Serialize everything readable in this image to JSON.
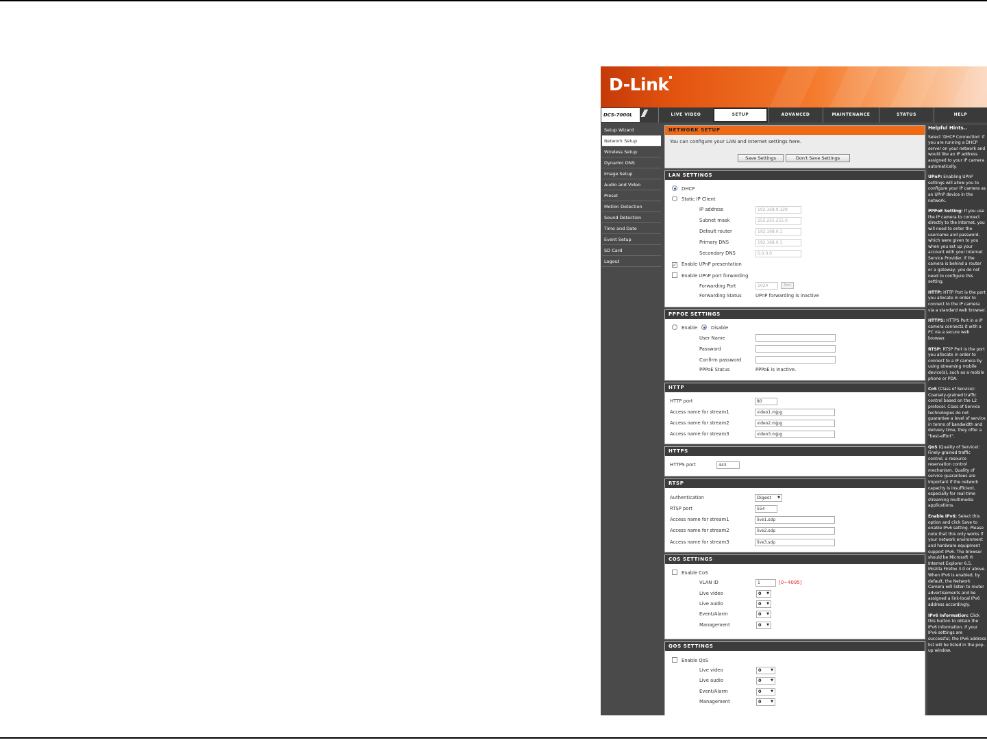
{
  "header": {
    "logo": "D-Link",
    "model": "DCS-7000L"
  },
  "nav": {
    "tabs": [
      "LIVE VIDEO",
      "SETUP",
      "ADVANCED",
      "MAINTENANCE",
      "STATUS",
      "HELP"
    ],
    "active": "SETUP"
  },
  "sidebar": {
    "items": [
      "Setup Wizard",
      "Network Setup",
      "Wireless Setup",
      "Dynamic DNS",
      "Image Setup",
      "Audio and Video",
      "Preset",
      "Motion Detection",
      "Sound Detection",
      "Time and Date",
      "Event Setup",
      "SD Card",
      "Logout"
    ],
    "active": "Network Setup"
  },
  "network_setup": {
    "title": "NETWORK SETUP",
    "intro": "You can configure your LAN and Internet settings here.",
    "save_label": "Save Settings",
    "dont_save_label": "Don't Save Settings"
  },
  "lan": {
    "title": "LAN SETTINGS",
    "dhcp": "DHCP",
    "static": "Static IP Client",
    "ip_label": "IP address",
    "ip_value": "192.168.0.129",
    "subnet_label": "Subnet mask",
    "subnet_value": "255.255.255.0",
    "router_label": "Default router",
    "router_value": "192.168.0.1",
    "dns1_label": "Primary DNS",
    "dns1_value": "192.168.0.1",
    "dns2_label": "Secondary DNS",
    "dns2_value": "0.0.0.0",
    "upnp_presentation": "Enable UPnP presentation",
    "upnp_forwarding": "Enable UPnP port forwarding",
    "fwd_port_label": "Forwarding Port",
    "fwd_port_value": "1024",
    "test_label": "Test",
    "fwd_status_label": "Forwarding Status",
    "fwd_status_value": "UPnP forwarding is inactive"
  },
  "pppoe": {
    "title": "PPPOE SETTINGS",
    "enable": "Enable",
    "disable": "Disable",
    "user_label": "User Name",
    "pass_label": "Password",
    "confirm_label": "Confirm password",
    "status_label": "PPPoE Status",
    "status_value": "PPPoE is inactive."
  },
  "http": {
    "title": "HTTP",
    "port_label": "HTTP port",
    "port_value": "80",
    "s1_label": "Access name for stream1",
    "s1_value": "video1.mjpg",
    "s2_label": "Access name for stream2",
    "s2_value": "video2.mjpg",
    "s3_label": "Access name for stream3",
    "s3_value": "video3.mjpg"
  },
  "https": {
    "title": "HTTPS",
    "port_label": "HTTPS port",
    "port_value": "443"
  },
  "rtsp": {
    "title": "RTSP",
    "auth_label": "Authentication",
    "auth_value": "Digest",
    "port_label": "RTSP port",
    "port_value": "554",
    "s1_label": "Access name for stream1",
    "s1_value": "live1.sdp",
    "s2_label": "Access name for stream2",
    "s2_value": "live2.sdp",
    "s3_label": "Access name for stream3",
    "s3_value": "live3.sdp"
  },
  "cos": {
    "title": "COS SETTINGS",
    "enable": "Enable CoS",
    "vlan_label": "VLAN ID",
    "vlan_value": "1",
    "vlan_range": "[0~4095]",
    "video_label": "Live video",
    "video_value": "0",
    "audio_label": "Live audio",
    "audio_value": "0",
    "event_label": "Event/Alarm",
    "event_value": "0",
    "mgmt_label": "Management",
    "mgmt_value": "0"
  },
  "qos": {
    "title": "QOS SETTINGS",
    "enable": "Enable QoS",
    "video_label": "Live video",
    "video_value": "0",
    "audio_label": "Live audio",
    "audio_value": "0",
    "event_label": "Event/Alarm",
    "event_value": "0",
    "mgmt_label": "Management",
    "mgmt_value": "0"
  },
  "help": {
    "title": "Helpful Hints..",
    "paras": [
      {
        "head": "",
        "text": "Select 'DHCP Connection' if you are running a DHCP server on your network and would like an IP address assigned to your IP camera automatically."
      },
      {
        "head": "UPnP:",
        "text": " Enabling UPnP settings will allow you to configure your IP camera as an UPnP device in the network."
      },
      {
        "head": "PPPoE Setting:",
        "text": " If you use the IP camera to connect directly to the Internet, you will need to enter the username and password, which were given to you when you set up your account with your Internet Service Provider. If the camera is behind a router or a gateway, you do not need to configure this setting."
      },
      {
        "head": "HTTP:",
        "text": " HTTP Port is the port you allocate in order to connect to the IP camera via a standard web browser."
      },
      {
        "head": "HTTPS:",
        "text": " HTTPS Port in a IP camera connects it with a PC via a secure web browser."
      },
      {
        "head": "RTSP:",
        "text": " RTSP Port is the port you allocate in order to connect to a IP camera by using streaming mobile device(s), such as a mobile phone or PDA."
      },
      {
        "head": "CoS",
        "text": " (Class of Service): Coarsely-grained traffic control based on the L2 protocol. Class of Service technologies do not guarantee a level of service in terms of bandwidth and delivery time, they offer a \"best-effort\"."
      },
      {
        "head": "QoS",
        "text": " (Quality of Service): Finely-grained traffic control, a resource reservation control mechanism. Quality of service guarantees are important if the network capacity is insufficient, especially for real-time streaming multimedia applications."
      },
      {
        "head": "Enable IPv6:",
        "text": " Select this option and click Save to enable IPv6 setting. Please note that this only works if your network environment and hardware equipment support IPv6. The browser should be Microsoft ® Internet Explorer 6.5, Mozilla Firefox 3.0 or above. When IPv6 is enabled, by default, the Network Camera will listen to router advertisements and be assigned a link-local IPv6 address accordingly."
      },
      {
        "head": "IPv6 Information:",
        "text": " Click this button to obtain the IPv6 information. If your IPv6 settings are successful, the IPv6 address list will be listed in the pop-up window."
      }
    ]
  }
}
